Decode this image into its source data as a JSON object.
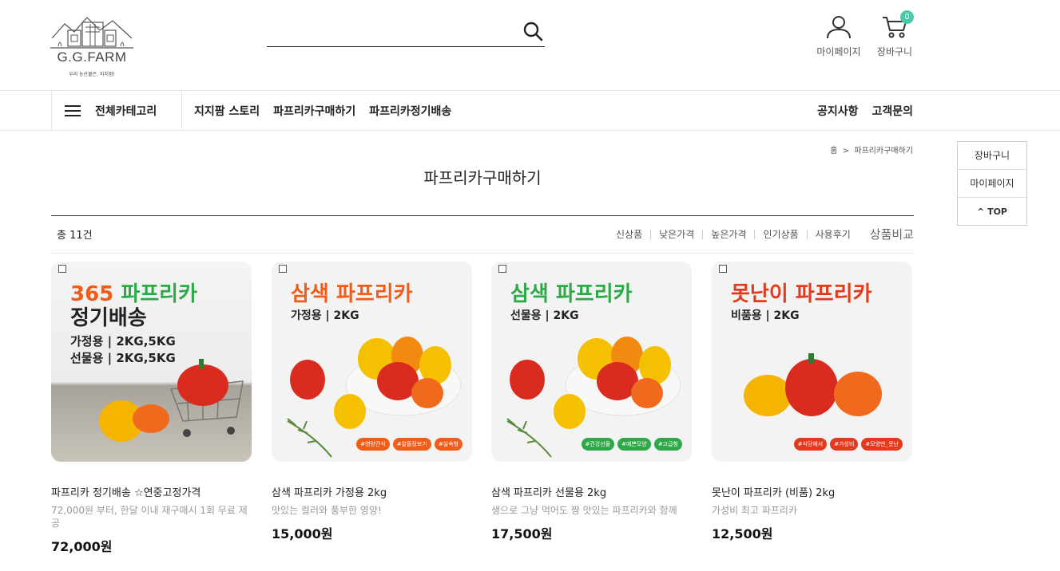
{
  "header": {
    "logo_text": "G.G.FARM",
    "logo_tagline": "우리 농산물은, 지지팜!",
    "search_placeholder": "",
    "mypage_label": "마이페이지",
    "cart_label": "장바구니",
    "cart_count": "0"
  },
  "nav": {
    "all_category": "전체카테고리",
    "menu": [
      "지지팜 스토리",
      "파프리카구매하기",
      "파프리카정기배송"
    ],
    "right": [
      "공지사항",
      "고객문의"
    ]
  },
  "quick_menu": [
    "장바구니",
    "마이페이지",
    "TOP"
  ],
  "breadcrumb": {
    "home": "홈",
    "current": "파프리카구매하기"
  },
  "page_title": "파프리카구매하기",
  "list": {
    "total": "총 11건",
    "sorts": [
      "신상품",
      "낮은가격",
      "높은가격",
      "인기상품",
      "사용후기"
    ],
    "compare": "상품비교"
  },
  "colors": {
    "accent": "#4cc9a8",
    "orange": "#f25c19",
    "green": "#2fa84a",
    "red": "#e23a1c"
  },
  "products": [
    {
      "image": {
        "title_a": "365",
        "title_b": "파프리카",
        "title_2": "정기배송",
        "lines": [
          "가정용 | 2KG,5KG",
          "선물용 | 2KG,5KG"
        ]
      },
      "name": "파프리카 정기배송 ☆연중고정가격",
      "desc": "72,000원 부터, 한달 이내 재구매시 1회 무료 제공",
      "price": "72,000원"
    },
    {
      "image": {
        "title": "삼색 파프리카",
        "sub": "가정용 | 2KG",
        "tags": [
          "#영양간식",
          "#알뜰장보기",
          "#실속형"
        ]
      },
      "name": "삼색 파프리카 가정용 2kg",
      "desc": "맛있는 컬러와 풍부한 영양!",
      "price": "15,000원"
    },
    {
      "image": {
        "title": "삼색 파프리카",
        "sub": "선물용 | 2KG",
        "tags": [
          "#건강선물",
          "#예쁜모양",
          "#고급형"
        ]
      },
      "name": "삼색 파프리카 선물용 2kg",
      "desc": "생으로 그냥 먹어도 짱 맛있는 파프리카와 함께",
      "price": "17,500원"
    },
    {
      "image": {
        "title": "못난이 파프리카",
        "sub": "비품용 | 2KG",
        "tags": [
          "#식당에서",
          "#가성비",
          "#모양만_못난"
        ]
      },
      "name": "못난이 파프리카 (비품) 2kg",
      "desc": "가성비 최고 파프리카",
      "price": "12,500원"
    }
  ]
}
